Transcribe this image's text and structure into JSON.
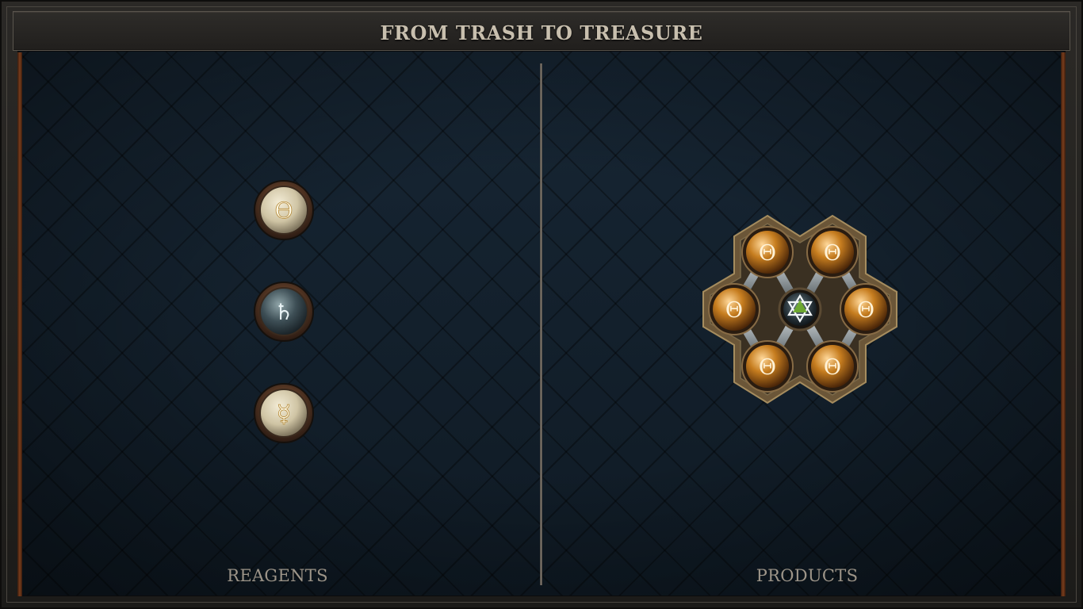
{
  "title": "FROM TRASH TO TREASURE",
  "panels": {
    "reagents_label": "REAGENTS",
    "products_label": "PRODUCTS"
  },
  "reagents": [
    {
      "name": "salt",
      "glyph": "ϴ",
      "style": "light"
    },
    {
      "name": "lead",
      "glyph": "♄",
      "style": "dark"
    },
    {
      "name": "quicksilver",
      "glyph": "☿",
      "style": "light"
    }
  ],
  "product": {
    "name": "gold-ring-molecule",
    "outer_glyph": "Θ",
    "outer_count": 6,
    "center_icon": "star-of-david-icon"
  },
  "colors": {
    "title_text": "#c8bfae",
    "label_text": "#9c9488",
    "board_bg": "#12202c",
    "gold_atom": "#c67d1f",
    "rail": "#7a3d1c"
  }
}
